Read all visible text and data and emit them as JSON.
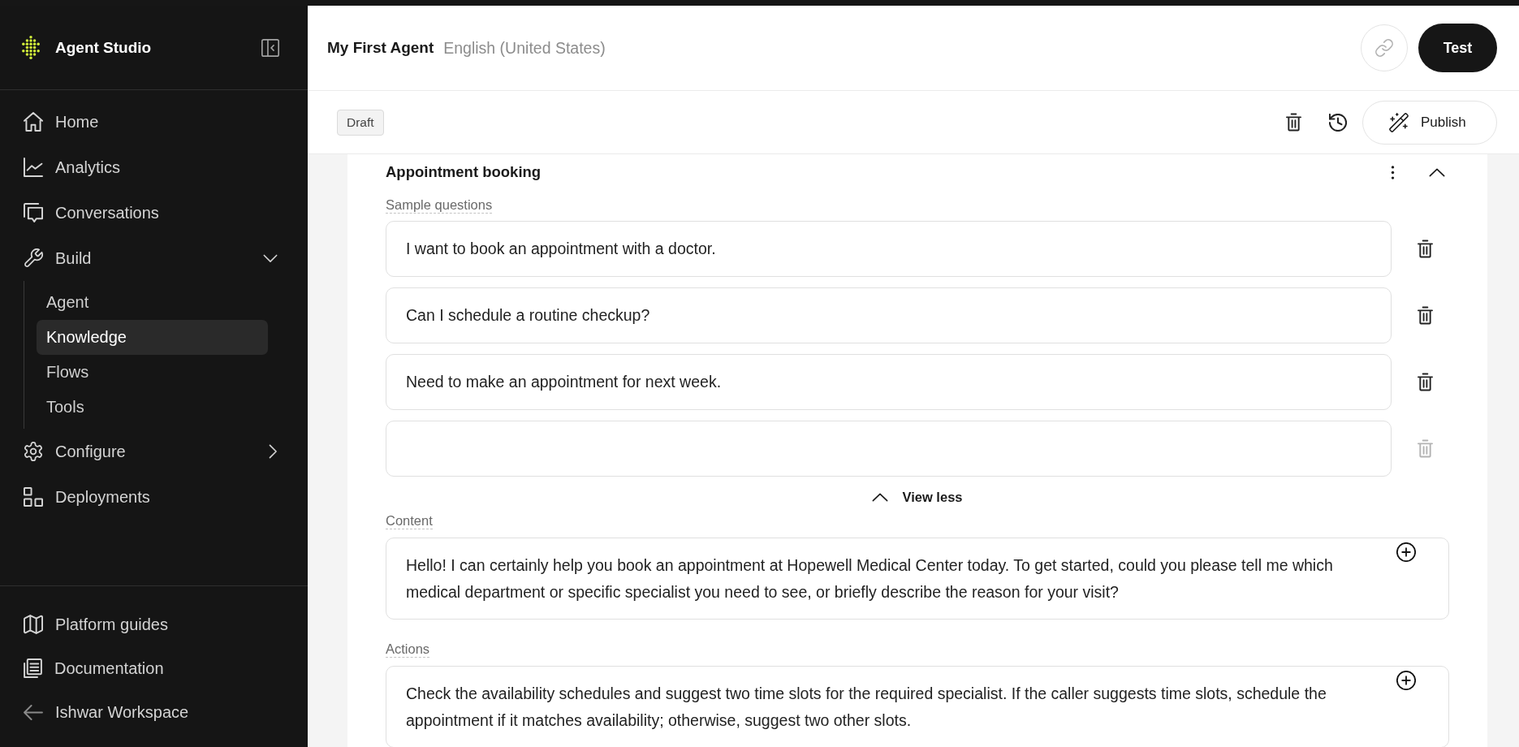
{
  "sidebar": {
    "brand": "Agent Studio",
    "nav": [
      {
        "label": "Home",
        "selected": false
      },
      {
        "label": "Analytics",
        "selected": false
      },
      {
        "label": "Conversations",
        "selected": false
      },
      {
        "label": "Build",
        "selected": false,
        "expanded": true,
        "children": [
          {
            "label": "Agent",
            "selected": false
          },
          {
            "label": "Knowledge",
            "selected": true
          },
          {
            "label": "Flows",
            "selected": false
          },
          {
            "label": "Tools",
            "selected": false
          }
        ]
      },
      {
        "label": "Configure",
        "selected": false,
        "expanded": false
      },
      {
        "label": "Deployments",
        "selected": false
      }
    ],
    "footer": [
      {
        "label": "Platform guides"
      },
      {
        "label": "Documentation"
      },
      {
        "label": "Ishwar Workspace"
      }
    ]
  },
  "header": {
    "title": "My First Agent",
    "language": "English (United States)",
    "test_button": "Test"
  },
  "toolbar": {
    "status": "Draft",
    "publish_button": "Publish"
  },
  "card": {
    "title": "Appointment booking",
    "expanded": true,
    "sample_questions": {
      "label": "Sample questions",
      "items": [
        {
          "text": "I want to book an appointment with a doctor.",
          "delete_disabled": false
        },
        {
          "text": "Can I schedule a routine checkup?",
          "delete_disabled": false
        },
        {
          "text": "Need to make an appointment for next week.",
          "delete_disabled": false
        },
        {
          "delete_disabled": true
        }
      ],
      "toggle": "View less"
    },
    "fields": [
      {
        "label": "Content",
        "value": "Hello! I can certainly help you book an appointment at Hopewell Medical Center today. To get started, could you please tell me which medical department or specific specialist you need to see, or briefly describe the reason for your visit?"
      },
      {
        "label": "Actions",
        "value": "Check the availability schedules and suggest two time slots for the required specialist. If the caller suggests time slots, schedule the appointment if it matches availability; otherwise, suggest two other slots."
      }
    ]
  }
}
